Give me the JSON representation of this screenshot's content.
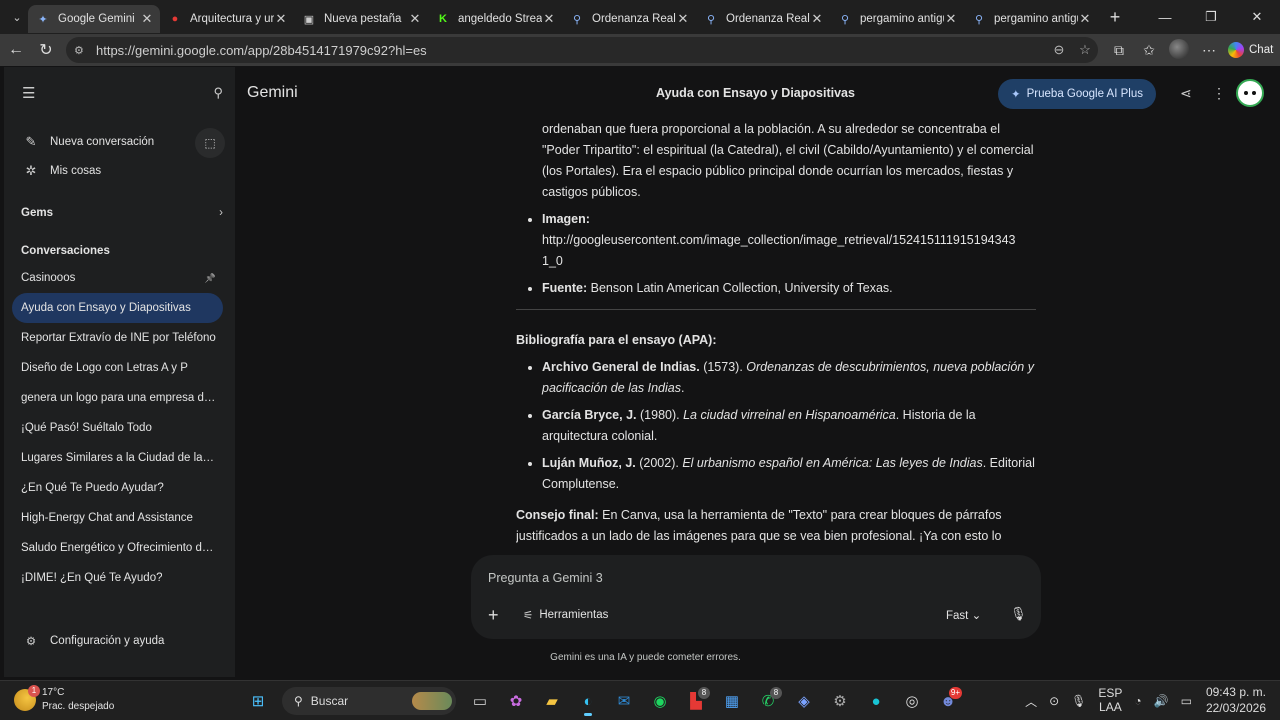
{
  "browser": {
    "tabs": [
      {
        "title": "Google Gemini",
        "active": true,
        "icon": "gemini-icon"
      },
      {
        "title": "Arquitectura y urba",
        "active": false,
        "icon": "red-app-icon"
      },
      {
        "title": "Nueva pestaña",
        "active": false,
        "icon": "newtab-icon"
      },
      {
        "title": "angeldedo Stream",
        "active": false,
        "icon": "kick-icon"
      },
      {
        "title": "Ordenanza Real de",
        "active": false,
        "icon": "search-icon"
      },
      {
        "title": "Ordenanza Real de",
        "active": false,
        "icon": "search-icon"
      },
      {
        "title": "pergamino antiguo",
        "active": false,
        "icon": "search-icon"
      },
      {
        "title": "pergamino antiguo",
        "active": false,
        "icon": "search-icon"
      }
    ],
    "url": "https://gemini.google.com/app/28b4514171979c92?hl=es",
    "chat_label": "Chat"
  },
  "sidebar": {
    "new_conversation": "Nueva conversación",
    "my_stuff": "Mis cosas",
    "gems": "Gems",
    "conversations_heading": "Conversaciones",
    "conversations": [
      {
        "title": "Casinooos",
        "pinned": true,
        "active": false
      },
      {
        "title": "Ayuda con Ensayo y Diapositivas",
        "pinned": false,
        "active": true
      },
      {
        "title": "Reportar Extravío de INE por Teléfono",
        "pinned": false,
        "active": false
      },
      {
        "title": "Diseño de Logo con Letras A y P",
        "pinned": false,
        "active": false
      },
      {
        "title": "genera un logo para una empresa de ...",
        "pinned": false,
        "active": false
      },
      {
        "title": "¡Qué Pasó! Suéltalo Todo",
        "pinned": false,
        "active": false
      },
      {
        "title": "Lugares Similares a la Ciudad de las A...",
        "pinned": false,
        "active": false
      },
      {
        "title": "¿En Qué Te Puedo Ayudar?",
        "pinned": false,
        "active": false
      },
      {
        "title": "High-Energy Chat and Assistance",
        "pinned": false,
        "active": false
      },
      {
        "title": "Saludo Energético y Ofrecimiento de ...",
        "pinned": false,
        "active": false
      },
      {
        "title": "¡DIME! ¿En Qué Te Ayudo?",
        "pinned": false,
        "active": false
      }
    ],
    "settings": "Configuración y ayuda"
  },
  "header": {
    "brand": "Gemini",
    "conversation_title": "Ayuda con Ensayo y Diapositivas",
    "upgrade": "Prueba Google AI Plus"
  },
  "content": {
    "para_cont": "ordenaban que fuera proporcional a la población. A su alrededor se concentraba el \"Poder Tripartito\": el espiritual (la Catedral), el civil (Cabildo/Ayuntamiento) y el comercial (los Portales). Era el espacio público principal donde ocurrían los mercados, fiestas y castigos públicos.",
    "image_label": "Imagen:",
    "image_url": "http://googleusercontent.com/image_collection/image_retrieval/152415111915194343​1_0",
    "source_label": "Fuente:",
    "source_text": "Benson Latin American Collection, University of Texas.",
    "bib_heading": "Bibliografía para el ensayo (APA):",
    "bib": [
      {
        "author": "Archivo General de Indias.",
        "year": "(1573).",
        "title": "Ordenanzas de descubrimientos, nueva población y pacificación de las Indias",
        "rest": "."
      },
      {
        "author": "García Bryce, J.",
        "year": "(1980).",
        "title": "La ciudad virreinal en Hispanoamérica",
        "rest": ". Historia de la arquitectura colonial."
      },
      {
        "author": "Luján Muñoz, J.",
        "year": "(2002).",
        "title": "El urbanismo español en América: Las leyes de Indias",
        "rest": ". Editorial Complutense."
      }
    ],
    "final_label": "Consejo final:",
    "final_text": "En Canva, usa la herramienta de \"Texto\" para crear bloques de párrafos justificados a un lado de las imágenes para que se vea bien profesional. ¡Ya con esto lo tienes listo, we!"
  },
  "input": {
    "placeholder": "Pregunta a Gemini 3",
    "tools": "Herramientas",
    "mode": "Fast"
  },
  "disclaimer": "Gemini es una IA y puede cometer errores.",
  "taskbar": {
    "temp": "17°C",
    "weather": "Prac. despejado",
    "weather_badge": "1",
    "search": "Buscar",
    "badges": {
      "office": "8",
      "whatsapp": "8",
      "discord": "9+"
    },
    "lang1": "ESP",
    "lang2": "LAA",
    "time": "09:43 p. m.",
    "date": "22/03/2026"
  }
}
